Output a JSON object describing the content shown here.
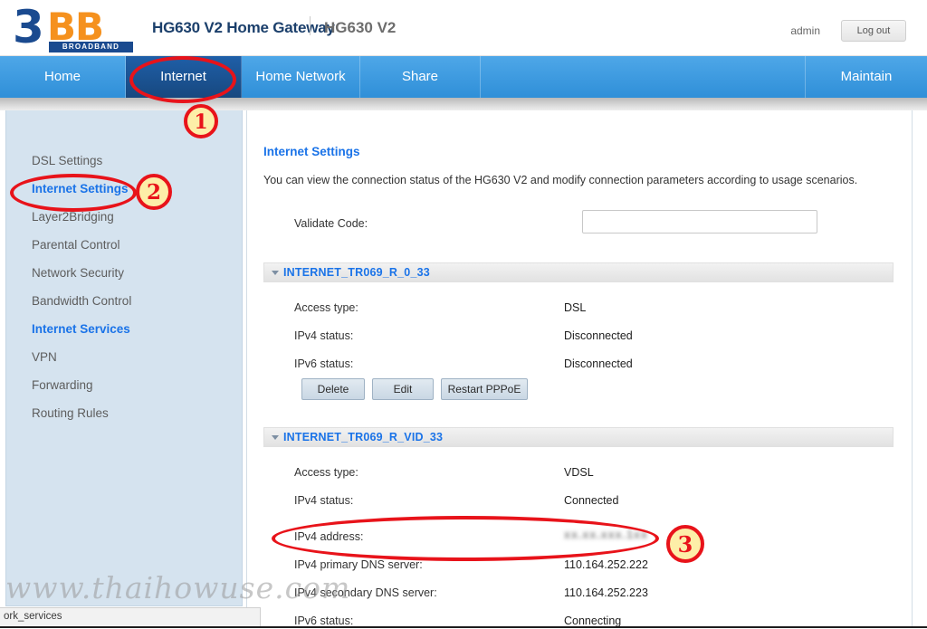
{
  "header": {
    "logo": {
      "mark3": "3",
      "markbb": "BB",
      "band": "BROADBAND"
    },
    "title_main": "HG630 V2 Home Gateway",
    "title_model": "HG630 V2",
    "user": "admin",
    "logout_label": "Log out"
  },
  "nav": {
    "items": [
      {
        "label": "Home",
        "active": false
      },
      {
        "label": "Internet",
        "active": true
      },
      {
        "label": "Home Network",
        "active": false
      },
      {
        "label": "Share",
        "active": false
      },
      {
        "label": "Maintain",
        "active": false
      }
    ]
  },
  "sidebar": {
    "items": [
      {
        "label": "DSL Settings",
        "highlight": false
      },
      {
        "label": "Internet Settings",
        "highlight": true
      },
      {
        "label": "Layer2Bridging",
        "highlight": false
      },
      {
        "label": "Parental Control",
        "highlight": false
      },
      {
        "label": "Network Security",
        "highlight": false
      },
      {
        "label": "Bandwidth Control",
        "highlight": false
      },
      {
        "label": "Internet Services",
        "highlight": true
      },
      {
        "label": "VPN",
        "highlight": false
      },
      {
        "label": "Forwarding",
        "highlight": false
      },
      {
        "label": "Routing Rules",
        "highlight": false
      }
    ]
  },
  "main": {
    "page_title": "Internet Settings",
    "description": "You can view the connection status of the HG630 V2 and modify connection parameters according to usage scenarios.",
    "validate_code": {
      "label": "Validate Code:",
      "value": "",
      "placeholder": ""
    },
    "sections": [
      {
        "title": "INTERNET_TR069_R_0_33",
        "rows": [
          {
            "label": "Access type:",
            "value": "DSL",
            "blurred": false
          },
          {
            "label": "IPv4 status:",
            "value": "Disconnected",
            "blurred": false
          },
          {
            "label": "IPv6 status:",
            "value": "Disconnected",
            "blurred": false
          }
        ],
        "buttons": [
          {
            "label": "Delete"
          },
          {
            "label": "Edit"
          },
          {
            "label": "Restart PPPoE"
          }
        ]
      },
      {
        "title": "INTERNET_TR069_R_VID_33",
        "rows": [
          {
            "label": "Access type:",
            "value": "VDSL",
            "blurred": false
          },
          {
            "label": "IPv4 status:",
            "value": "Connected",
            "blurred": false
          },
          {
            "label": "IPv4 address:",
            "value": "xx.xx.xxx.1xx",
            "blurred": true
          },
          {
            "label": "IPv4 primary DNS server:",
            "value": "110.164.252.222",
            "blurred": false
          },
          {
            "label": "IPv4 secondary DNS server:",
            "value": "110.164.252.223",
            "blurred": false
          },
          {
            "label": "IPv6 status:",
            "value": "Connecting",
            "blurred": false
          }
        ],
        "buttons": []
      }
    ]
  },
  "annotations": {
    "step1": "1",
    "step2": "2",
    "step3": "3",
    "accent_color": "#e8131a",
    "fill_color": "#fdeea8"
  },
  "watermark": "www.thaihowuse.com",
  "statusbar": {
    "text": "ork_services"
  }
}
